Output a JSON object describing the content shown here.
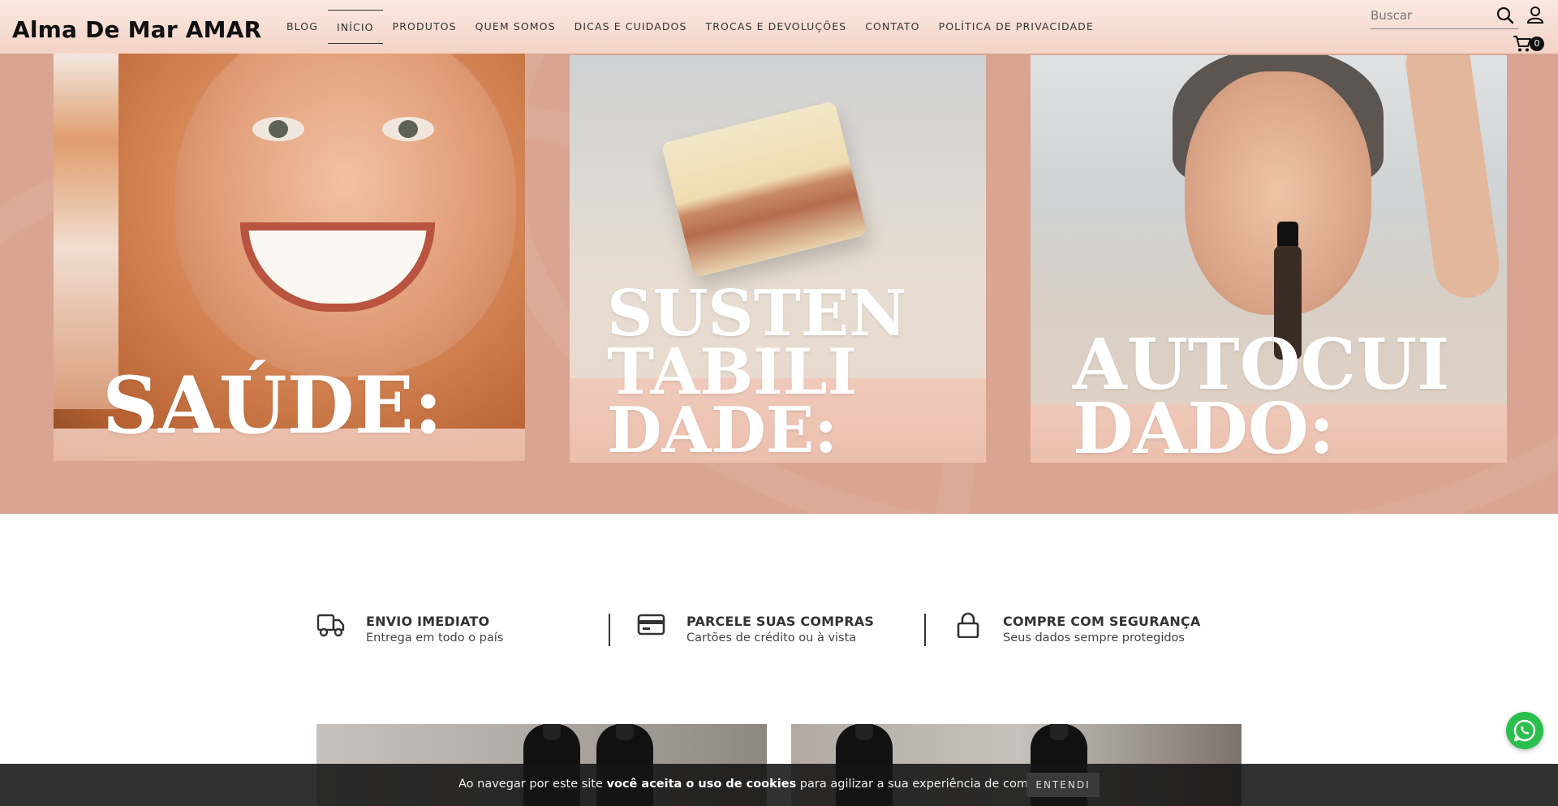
{
  "header": {
    "logo": "Alma De Mar AMAR",
    "nav": [
      {
        "label": "BLOG"
      },
      {
        "label": "INÍCIO"
      },
      {
        "label": "PRODUTOS"
      },
      {
        "label": "QUEM SOMOS"
      },
      {
        "label": "DICAS E CUIDADOS"
      },
      {
        "label": "TROCAS E DEVOLUÇÕES"
      },
      {
        "label": "CONTATO"
      },
      {
        "label": "POLÍTICA DE PRIVACIDADE"
      }
    ],
    "active_nav": "INÍCIO",
    "search": {
      "placeholder": "Buscar",
      "value": ""
    },
    "cart_count": "0",
    "icons": {
      "search": "search-icon",
      "user": "user-icon",
      "cart": "cart-icon"
    }
  },
  "hero": {
    "panels": [
      {
        "word": "SAÚDE:"
      },
      {
        "word": "SUSTEN\nTABILI\nDADE:"
      },
      {
        "word": "AUTOCUI\nDADO:"
      }
    ],
    "background_color": "#d9a592"
  },
  "features": [
    {
      "icon": "truck-icon",
      "title": "ENVIO IMEDIATO",
      "subtitle": "Entrega em todo o país"
    },
    {
      "icon": "credit-card-icon",
      "title": "PARCELE SUAS COMPRAS",
      "subtitle": "Cartões de crédito ou à vista"
    },
    {
      "icon": "lock-icon",
      "title": "COMPRE COM SEGURANÇA",
      "subtitle": "Seus dados sempre protegidos"
    }
  ],
  "whatsapp": {
    "icon": "whatsapp-icon",
    "color": "#2bbf4e"
  },
  "cookie": {
    "text_before": "Ao navegar por este site ",
    "text_bold": "você aceita o uso de cookies",
    "text_after": " para agilizar a sua experiência de compra.",
    "button": "ENTENDI"
  }
}
